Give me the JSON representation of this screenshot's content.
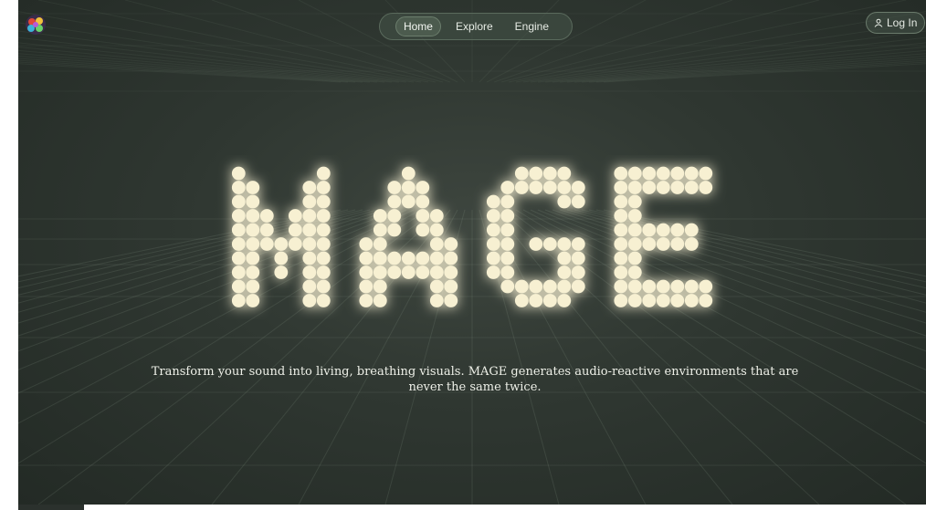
{
  "brand": {
    "logo_icon": "colorful-mage-logo-icon",
    "wordmark": "MAGE"
  },
  "nav": {
    "items": [
      {
        "label": "Home",
        "active": true
      },
      {
        "label": "Explore",
        "active": false
      },
      {
        "label": "Engine",
        "active": false
      }
    ]
  },
  "login": {
    "label": "Log In",
    "icon": "user-icon"
  },
  "hero": {
    "tagline": "Transform your sound into living, breathing visuals. MAGE generates audio-reactive environments that are never the same twice."
  },
  "colors": {
    "background": "#2f3731",
    "dot": "#f7f0d2",
    "glow": "#fff4c8",
    "nav_bg": "#46544a"
  }
}
